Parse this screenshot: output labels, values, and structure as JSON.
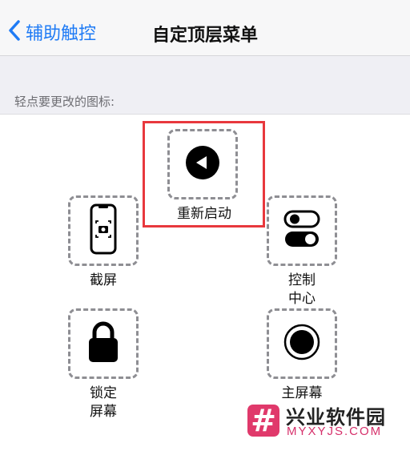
{
  "navbar": {
    "back_label": "辅助触控",
    "title": "自定顶层菜单"
  },
  "section": {
    "label": "轻点要更改的图标:"
  },
  "items": [
    {
      "label": "重新启动",
      "icon": "back-play-icon"
    },
    {
      "label": "截屏",
      "icon": "screenshot-icon"
    },
    {
      "label": "控制\n中心",
      "icon": "toggles-icon"
    },
    {
      "label": "锁定\n屏幕",
      "icon": "lock-icon"
    },
    {
      "label": "主屏幕",
      "icon": "home-button-icon"
    }
  ],
  "highlight_color": "#e8383d",
  "accent_color": "#1f7bf5",
  "watermark": {
    "badge": "#",
    "name": "兴业软件园",
    "site": "MYXYJS.COM"
  }
}
